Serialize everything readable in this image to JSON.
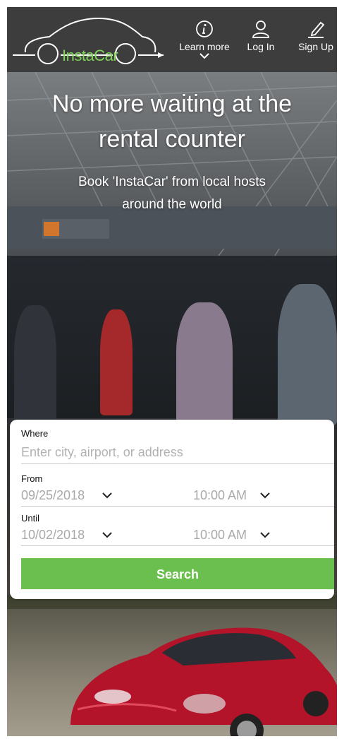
{
  "header": {
    "brand": "InstaCar",
    "nav": {
      "learn_more": "Learn more",
      "log_in": "Log In",
      "sign_up": "Sign Up"
    }
  },
  "hero": {
    "title_line1": "No more waiting at the",
    "title_line2": "rental counter",
    "subtitle_line1": "Book 'InstaCar' from local hosts",
    "subtitle_line2": "around the world"
  },
  "form": {
    "where_label": "Where",
    "where_placeholder": "Enter city, airport, or address",
    "from_label": "From",
    "from_date": "09/25/2018",
    "from_time": "10:00 AM",
    "until_label": "Until",
    "until_date": "10/02/2018",
    "until_time": "10:00 AM",
    "search_label": "Search"
  },
  "colors": {
    "header_bg": "#3c3d3c",
    "brand_green": "#7fd35a",
    "search_green": "#6bbf4e"
  },
  "icons": {
    "learn_more": "info-icon",
    "log_in": "user-icon",
    "sign_up": "pen-signup-icon",
    "dropdown": "chevron-down-icon"
  }
}
